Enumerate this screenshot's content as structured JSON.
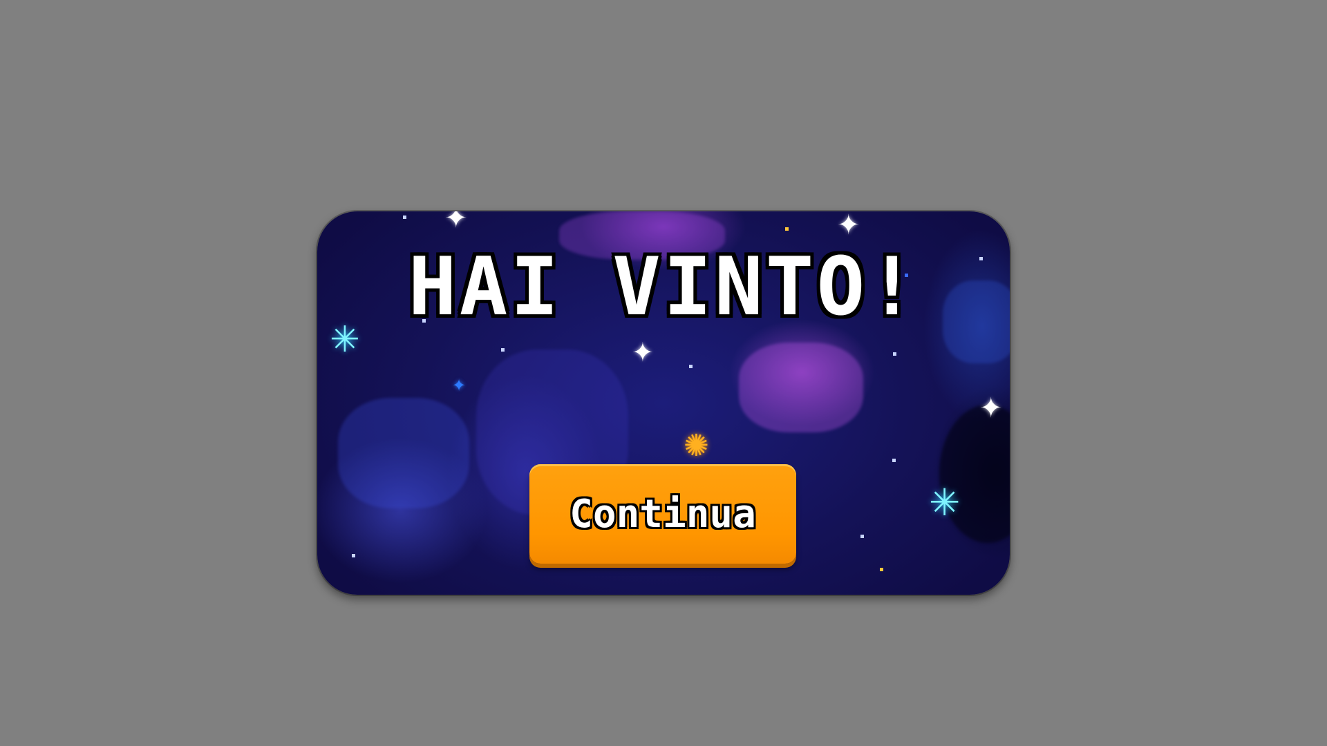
{
  "dialog": {
    "title": "HAI VINTO!",
    "button_label": "Continua"
  },
  "icons": {
    "star": "sparkle-star-icon",
    "sun": "sun-sparkle-icon"
  },
  "colors": {
    "background": "#808080",
    "space": "#141257",
    "button": "#ff9600",
    "button_shadow": "#c06a00",
    "nebula_purple": "#be50e6",
    "nebula_blue": "#4650dc"
  }
}
